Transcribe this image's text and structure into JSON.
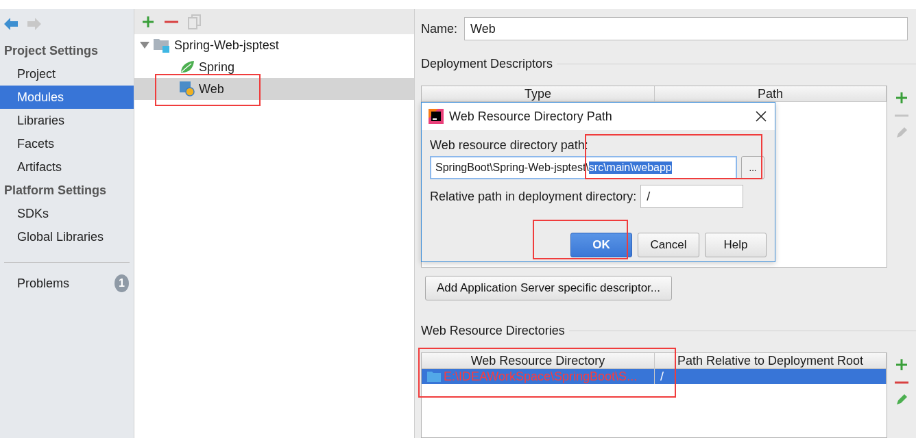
{
  "sidebar": {
    "sections": [
      {
        "title": "Project Settings",
        "items": [
          {
            "label": "Project",
            "selected": false
          },
          {
            "label": "Modules",
            "selected": true
          },
          {
            "label": "Libraries",
            "selected": false
          },
          {
            "label": "Facets",
            "selected": false
          },
          {
            "label": "Artifacts",
            "selected": false
          }
        ]
      },
      {
        "title": "Platform Settings",
        "items": [
          {
            "label": "SDKs",
            "selected": false
          },
          {
            "label": "Global Libraries",
            "selected": false
          }
        ]
      }
    ],
    "problems": {
      "label": "Problems",
      "count": "1"
    }
  },
  "tree": [
    {
      "label": "Spring-Web-jsptest",
      "kind": "module",
      "expanded": true,
      "selected": false,
      "children": [
        {
          "label": "Spring",
          "kind": "spring",
          "selected": false
        },
        {
          "label": "Web",
          "kind": "web",
          "selected": true
        }
      ]
    }
  ],
  "facet": {
    "name_label": "Name:",
    "name_value": "Web",
    "descriptors": {
      "title": "Deployment Descriptors",
      "columns": [
        "Type",
        "Path"
      ],
      "add_button": "Add Application Server specific descriptor..."
    },
    "resources": {
      "title": "Web Resource Directories",
      "columns": [
        "Web Resource Directory",
        "Path Relative to Deployment Root"
      ],
      "rows": [
        {
          "directory": "E:\\IDEAWorkSpace\\SpringBoot\\S...",
          "path": "/",
          "selected": true,
          "invalid": true
        }
      ]
    }
  },
  "dialog": {
    "title": "Web Resource Directory Path",
    "path_label": "Web resource directory path:",
    "path_prefix": "SpringBoot\\Spring-Web-jsptest\\",
    "path_selection": "src\\main\\webapp",
    "browse_label": "...",
    "relative_label": "Relative path in deployment directory:",
    "relative_value": "/",
    "buttons": [
      {
        "label": "OK",
        "default": true
      },
      {
        "label": "Cancel",
        "default": false
      },
      {
        "label": "Help",
        "default": false
      }
    ]
  }
}
